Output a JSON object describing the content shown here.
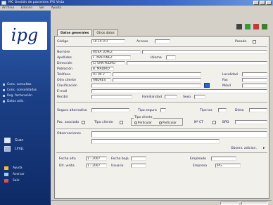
{
  "window": {
    "title": "MC Gestión de pacientes IPG Vista",
    "menu": [
      "Archivo",
      "Edición",
      "Ver",
      "Ayuda"
    ]
  },
  "sidebar": {
    "logo_text": "ipg",
    "nav": [
      {
        "label": "Cons. consultas"
      },
      {
        "label": "Cons. consolidadas"
      },
      {
        "label": "Reg. facturación"
      },
      {
        "label": "Datos adic."
      }
    ],
    "actions": [
      {
        "label": "Guar."
      },
      {
        "label": "Limp."
      }
    ],
    "bottom_actions": [
      {
        "label": "Ayuda"
      },
      {
        "label": "Acercar"
      },
      {
        "label": "Salir"
      }
    ]
  },
  "tabs": [
    {
      "label": "Datos generales",
      "active": true
    },
    {
      "label": "Otros datos",
      "active": false
    }
  ],
  "form": {
    "codigo": {
      "label": "Código",
      "value": "10 10 0 0"
    },
    "acceso": {
      "label": "Acceso"
    },
    "pasado": {
      "label": "Pasado"
    },
    "nombre": {
      "label": "Nombre",
      "value": "ROSA LOPEZ"
    },
    "apellidos": {
      "label": "Apellidos",
      "value": "L. MARTINEZ"
    },
    "idioma": {
      "label": "Idioma"
    },
    "direccion": {
      "label": "Dirección",
      "value": "C/ SAN PEDRO"
    },
    "poblacion": {
      "label": "Población",
      "value": "B. MADRID"
    },
    "telefono": {
      "label": "Teléfono",
      "value": "91 00 2"
    },
    "nif": {
      "label": "Otro cliente",
      "value": "ANDRES"
    },
    "localidad": {
      "label": "Localidad"
    },
    "email": {
      "label": "E-mail"
    },
    "clasificacion": {
      "label": "Clasificación"
    },
    "recibir": {
      "label": "Recibir"
    },
    "familiaridad": {
      "label": "Familiaridad"
    },
    "sexo": {
      "label": "Sexo"
    },
    "telefono2": {
      "label": "Teléfono"
    },
    "fax": {
      "label": "Fax"
    },
    "movil": {
      "label": "Móvil"
    },
    "seguro": {
      "label": "Seguro alternativo"
    },
    "tipo_seguro": {
      "label": "Tipo seguro"
    },
    "tipo_tar": {
      "label": "Tipo tar."
    },
    "dieta": {
      "label": "Dieta"
    },
    "pac_asoc": {
      "label": "Pac. asociado"
    },
    "tipo_cliente": {
      "label": "Tipo cliente"
    },
    "tipo_cliente_opts": [
      "Particular",
      "Particular"
    ],
    "nro_ct": {
      "label": "Nº CT"
    },
    "bpd": {
      "label": "BPD"
    },
    "observaciones": {
      "label": "Observaciones"
    },
    "observ_adic": {
      "label": "Observ. adicion."
    },
    "fecha_alta": {
      "label": "Fecha alta",
      "value": "1 - 2007"
    },
    "fecha_baja": {
      "label": "Fecha baja"
    },
    "ultima_visita": {
      "label": "Últ. visita",
      "value": "1 - 2007"
    },
    "empleado": {
      "label": "Empleado"
    },
    "usuario": {
      "label": "Usuario"
    },
    "empresa": {
      "label": "Empresa"
    },
    "empresa_value": "IPG"
  }
}
